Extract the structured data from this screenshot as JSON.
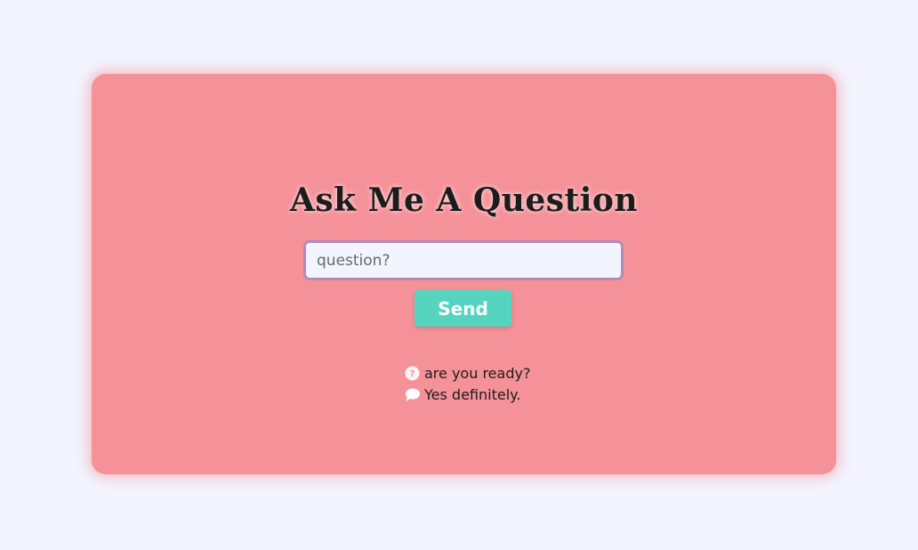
{
  "app": {
    "title": "Ask Me A Question"
  },
  "form": {
    "input_placeholder": "question?",
    "send_label": "Send"
  },
  "conversation": {
    "question_icon": "question-circle-icon",
    "question_text": "are you ready?",
    "answer_icon": "speech-bubble-icon",
    "answer_text": "Yes definitely."
  },
  "colors": {
    "page_background": "#f2f4fe",
    "card_background": "#f59198",
    "input_border": "#b48bb8",
    "button_background": "#55d4c0",
    "button_text": "#ffffff"
  }
}
